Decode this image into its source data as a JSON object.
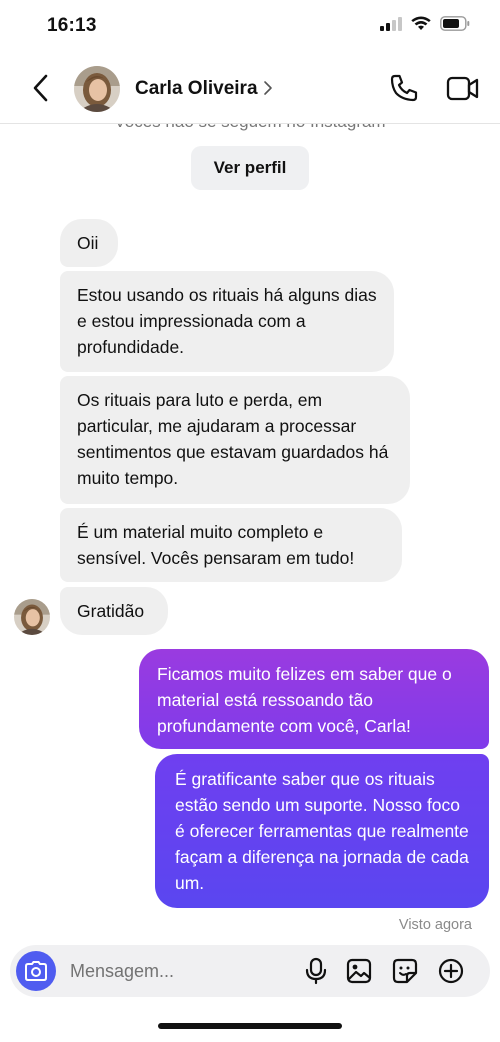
{
  "status_bar": {
    "time": "16:13"
  },
  "header": {
    "contact_name": "Carla Oliveira"
  },
  "conversation": {
    "cut_off_notice": "Vocês não se seguem no Instagram",
    "view_profile_label": "Ver perfil",
    "incoming": [
      {
        "text": "Oii"
      },
      {
        "text": "Estou usando os rituais há alguns dias e estou impressionada com a profundidade."
      },
      {
        "text": "Os rituais para luto e perda, em particular, me ajudaram a processar sentimentos que estavam guardados há muito tempo."
      },
      {
        "text": "É um material muito completo e sensível. Vocês pensaram em tudo!"
      },
      {
        "text": "Gratidão"
      }
    ],
    "outgoing": [
      {
        "text": "Ficamos muito felizes em saber que o material está ressoando tão profundamente com você, Carla!"
      },
      {
        "text": "É gratificante saber que os rituais estão sendo um suporte. Nosso foco é oferecer ferramentas que realmente façam a diferença na jornada de cada um."
      }
    ],
    "seen_status": "Visto agora"
  },
  "composer": {
    "placeholder": "Mensagem..."
  },
  "icons": {
    "back": "chevron-left-icon",
    "call": "phone-icon",
    "video": "video-camera-icon",
    "camera": "camera-icon",
    "mic": "microphone-icon",
    "gallery": "image-icon",
    "sticker": "sticker-icon",
    "plus": "plus-circle-icon"
  },
  "colors": {
    "accent": "#4f5cf0",
    "outgoing_top": "#9a3be0",
    "outgoing_bottom": "#5a46f0",
    "incoming_bg": "#efefef"
  }
}
